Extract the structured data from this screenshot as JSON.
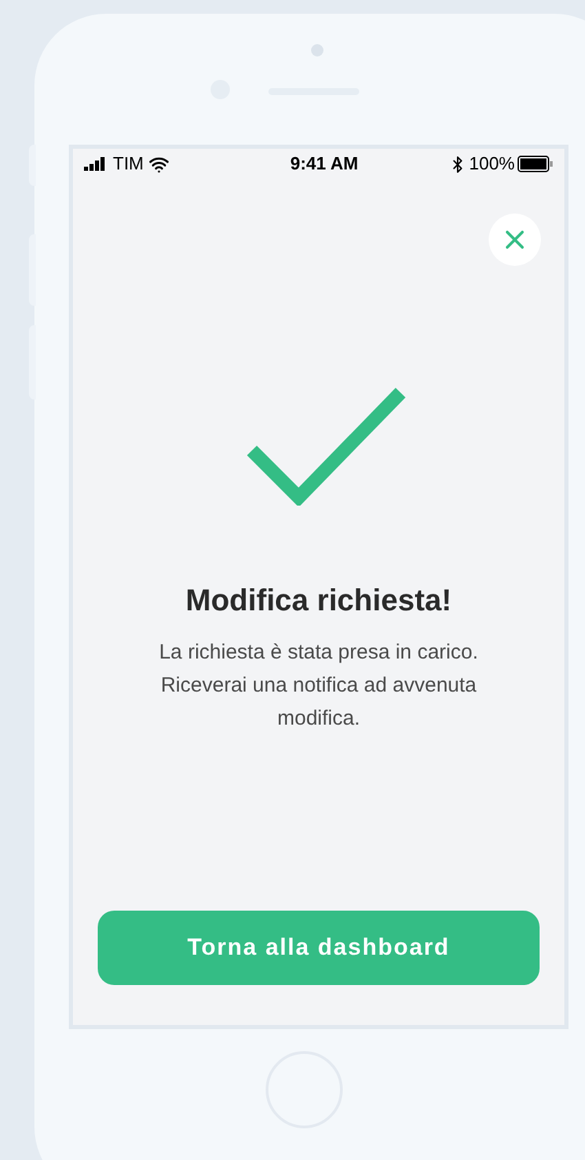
{
  "status_bar": {
    "carrier": "TIM",
    "time": "9:41 AM",
    "battery": "100%"
  },
  "title": "Modifica richiesta!",
  "message": "La richiesta è stata presa in carico. Riceverai una notifica ad avvenuta modifica.",
  "button": "Torna alla dashboard"
}
